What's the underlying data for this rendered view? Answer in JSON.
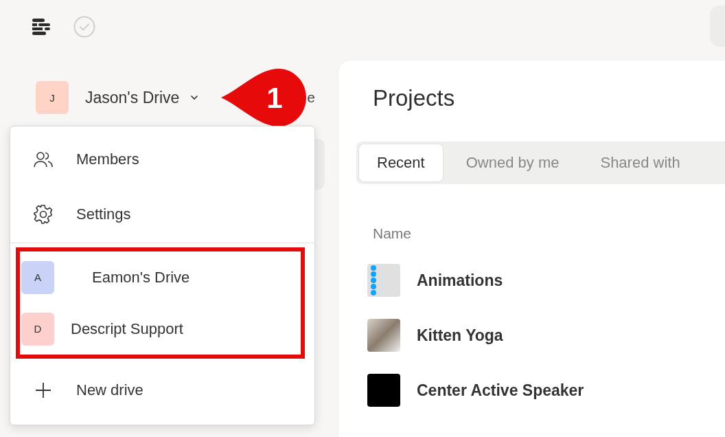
{
  "drive_switcher": {
    "avatar": "J",
    "color": "#fdd3c6",
    "name": "Jason's Drive",
    "text_behind_callout": "e"
  },
  "callout": {
    "number": "1"
  },
  "menu": {
    "highlighted": true,
    "items": [
      {
        "kind": "members",
        "label": "Members"
      },
      {
        "kind": "settings",
        "label": "Settings"
      }
    ],
    "drives": [
      {
        "avatar": "A",
        "name": "Eamon's Drive",
        "color": "#c9d3f7"
      },
      {
        "avatar": "D",
        "name": "Descript Support",
        "color": "#fdcfcd"
      }
    ],
    "new_drive": {
      "label": "New drive"
    }
  },
  "main": {
    "title": "Projects",
    "tabs": [
      {
        "label": "Recent",
        "selected": true
      },
      {
        "label": "Owned by me",
        "selected": false
      },
      {
        "label": "Shared with",
        "selected": false
      }
    ],
    "columns": [
      "Name"
    ],
    "rows": [
      {
        "name": "Animations",
        "kind": "list"
      },
      {
        "name": "Kitten Yoga",
        "kind": "photo"
      },
      {
        "name": "Center Active Speaker",
        "kind": "dark"
      }
    ]
  }
}
